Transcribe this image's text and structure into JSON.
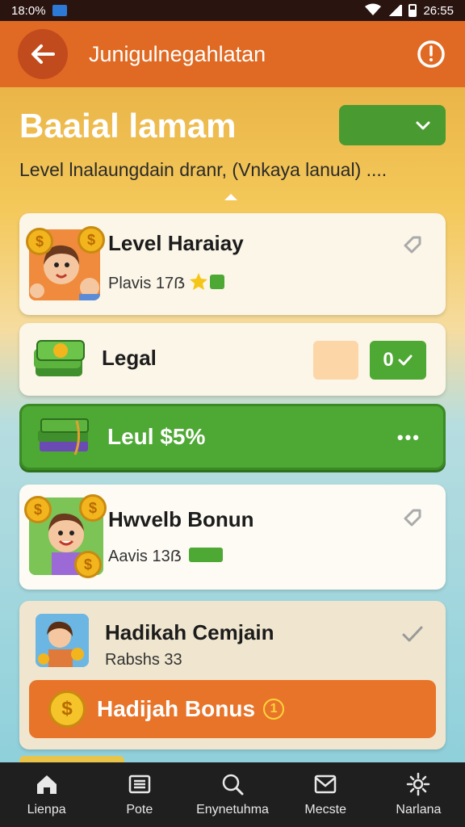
{
  "status_bar": {
    "left_text": "18:0%",
    "time": "26:55"
  },
  "app_bar": {
    "title": "Junigulnegahlatan"
  },
  "hero": {
    "title": "Baaial lamam",
    "subtitle": "Level lnalaungdain dranr, (Vnkaya lanual) ....",
    "accent_color": "#4a9a32"
  },
  "cards": [
    {
      "title": "Level Haraiay",
      "subtitle": "Plavis 17ẞ"
    },
    {
      "title": "Legal",
      "button_label": "0"
    },
    {
      "title": "Leul $5%"
    },
    {
      "title": "Hwvelb Bonun",
      "subtitle": "Aavis 13ẞ"
    },
    {
      "title": "Hadikah Cemjain",
      "subtitle": "Rabshs 33"
    }
  ],
  "bonus_button": {
    "label": "Hadijah Bonus",
    "badge": "1"
  },
  "bottom_nav": [
    {
      "label": "Lienpa",
      "icon": "home-icon"
    },
    {
      "label": "Pote",
      "icon": "list-icon"
    },
    {
      "label": "Enynetuhma",
      "icon": "search-icon"
    },
    {
      "label": "Mecste",
      "icon": "mail-icon"
    },
    {
      "label": "Narlana",
      "icon": "gear-icon"
    }
  ],
  "colors": {
    "header": "#e06a23",
    "green": "#4ea834",
    "orange": "#e8742a",
    "nav": "#1f1f1f"
  }
}
